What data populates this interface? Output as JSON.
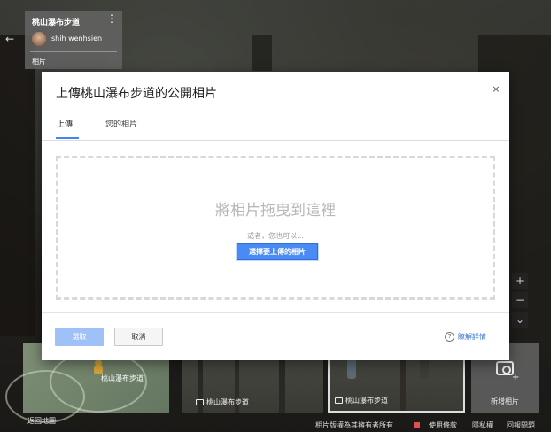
{
  "place_card": {
    "title": "桃山瀑布步道",
    "more_icon": "⋮",
    "user_name": "shih wenhsien",
    "photos_label": "相片"
  },
  "nav": {
    "back_icon": "←"
  },
  "map_controls": {
    "zoom_in": "+",
    "zoom_out": "−",
    "expand": "⌄"
  },
  "filmstrip": {
    "map_label": "桃山瀑布步道",
    "back_to_map": "返回地圖",
    "thumbnails": [
      {
        "label": "桃山瀑布步道"
      },
      {
        "label": "桃山瀑布步道"
      }
    ],
    "add_photo_label": "新增相片"
  },
  "footer": {
    "copyright": "相片版權為其擁有者所有",
    "terms": "使用條款",
    "privacy": "隱私權",
    "report": "回報問題",
    "flag_color": "#e05050"
  },
  "dialog": {
    "title": "上傳桃山瀑布步道的公開相片",
    "close_icon": "×",
    "tabs": [
      {
        "label": "上傳",
        "active": true
      },
      {
        "label": "您的相片",
        "active": false
      }
    ],
    "dropzone_text": "將相片拖曳到這裡",
    "or_text": "或者，您也可以...",
    "select_button": "選擇要上傳的相片",
    "pick_button": "選取",
    "cancel_button": "取消",
    "help_icon": "?",
    "learn_more": "瞭解詳情",
    "accent_color": "#4285f4"
  }
}
